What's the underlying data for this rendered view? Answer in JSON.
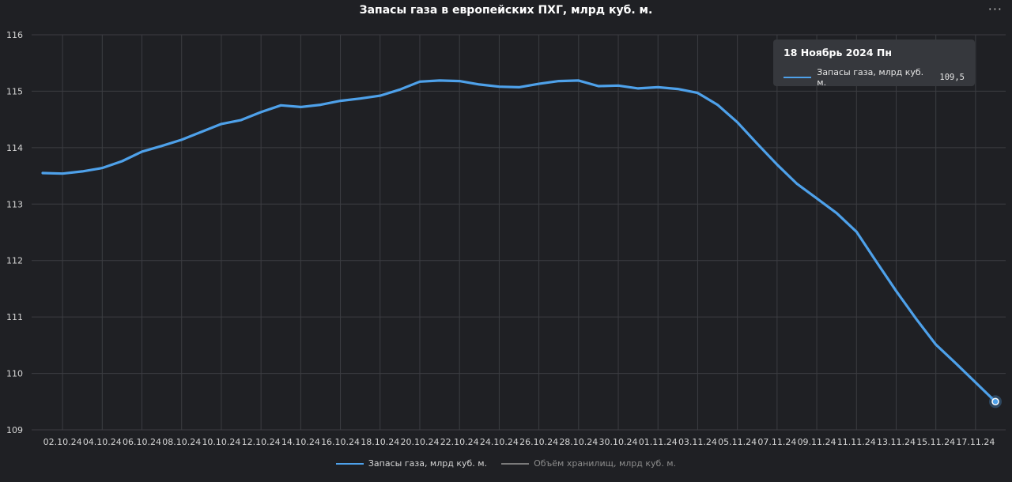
{
  "header": {
    "title": "Запасы газа в европейских ПХГ, млрд куб. м.",
    "menu_icon": "more-horizontal-icon",
    "menu_glyph": "···"
  },
  "colors": {
    "background": "#1f2024",
    "grid": "#3c3d42",
    "series1": "#4ea1ea",
    "series2": "#7a7a7a",
    "text": "#d5d5d5"
  },
  "tooltip": {
    "date": "18 Ноябрь 2024 Пн",
    "series": "Запасы газа, млрд куб. м.",
    "value": "109,5"
  },
  "chart_data": {
    "type": "line",
    "title": "Запасы газа в европейских ПХГ, млрд куб. м.",
    "ylim": [
      109,
      116
    ],
    "yticks": [
      109,
      110,
      111,
      112,
      113,
      114,
      115,
      116
    ],
    "grid": true,
    "legend": "bottom-center",
    "xticks": [
      "02.10.24",
      "04.10.24",
      "06.10.24",
      "08.10.24",
      "10.10.24",
      "12.10.24",
      "14.10.24",
      "16.10.24",
      "18.10.24",
      "20.10.24",
      "22.10.24",
      "24.10.24",
      "26.10.24",
      "28.10.24",
      "30.10.24",
      "01.11.24",
      "03.11.24",
      "05.11.24",
      "07.11.24",
      "09.11.24",
      "11.11.24",
      "13.11.24",
      "15.11.24",
      "17.11.24"
    ],
    "series": [
      {
        "name": "Запасы газа, млрд куб. м.",
        "values": [
          113.55,
          113.54,
          113.58,
          113.64,
          113.76,
          113.93,
          114.03,
          114.14,
          114.28,
          114.42,
          114.49,
          114.63,
          114.75,
          114.72,
          114.76,
          114.83,
          114.87,
          114.92,
          115.03,
          115.17,
          115.19,
          115.18,
          115.12,
          115.08,
          115.07,
          115.13,
          115.18,
          115.19,
          115.09,
          115.1,
          115.05,
          115.07,
          115.04,
          114.97,
          114.76,
          114.45,
          114.07,
          113.7,
          113.36,
          113.1,
          112.84,
          112.51,
          111.98,
          111.46,
          110.97,
          110.51,
          110.18,
          109.84,
          109.5
        ]
      },
      {
        "name": "Объём хранилищ, млрд куб. м.",
        "values": []
      }
    ]
  }
}
